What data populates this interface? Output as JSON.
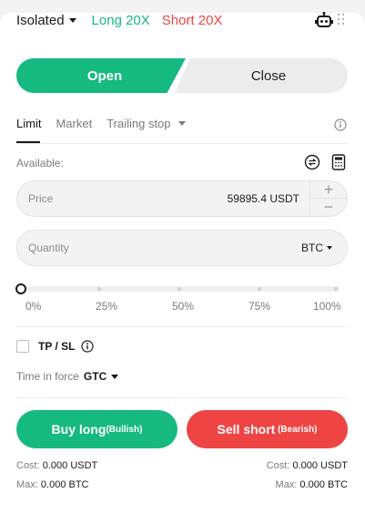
{
  "header": {
    "margin_mode": "Isolated",
    "long_leverage": "Long 20X",
    "short_leverage": "Short 20X",
    "robot_icon": "robot-icon",
    "drag_icon": "drag-handle-icon"
  },
  "switch": {
    "open": "Open",
    "close": "Close"
  },
  "tabs": {
    "limit": "Limit",
    "market": "Market",
    "trailing": "Trailing stop",
    "active": "Limit"
  },
  "available": {
    "label": "Available:"
  },
  "price": {
    "label": "Price",
    "value": "59895.4 USDT",
    "plus": "+",
    "minus": "−"
  },
  "quantity": {
    "label": "Quantity",
    "unit": "BTC"
  },
  "slider": {
    "value_percent": 0,
    "marks": [
      "0%",
      "25%",
      "50%",
      "75%",
      "100%"
    ]
  },
  "tpsl": {
    "label": "TP / SL",
    "checked": false
  },
  "time_in_force": {
    "label": "Time in force",
    "value": "GTC"
  },
  "buy": {
    "label": "Buy long",
    "sub": "(Bullish)"
  },
  "sell": {
    "label": "Sell short",
    "sub": " (Bearish)"
  },
  "buy_cost": {
    "cost_label": "Cost:",
    "cost_value": "0.000 USDT",
    "max_label": "Max:",
    "max_value": "0.000 BTC"
  },
  "sell_cost": {
    "cost_label": "Cost:",
    "cost_value": "0.000 USDT",
    "max_label": "Max:",
    "max_value": "0.000 BTC"
  },
  "colors": {
    "long": "#16b97f",
    "short": "#ef4444"
  }
}
